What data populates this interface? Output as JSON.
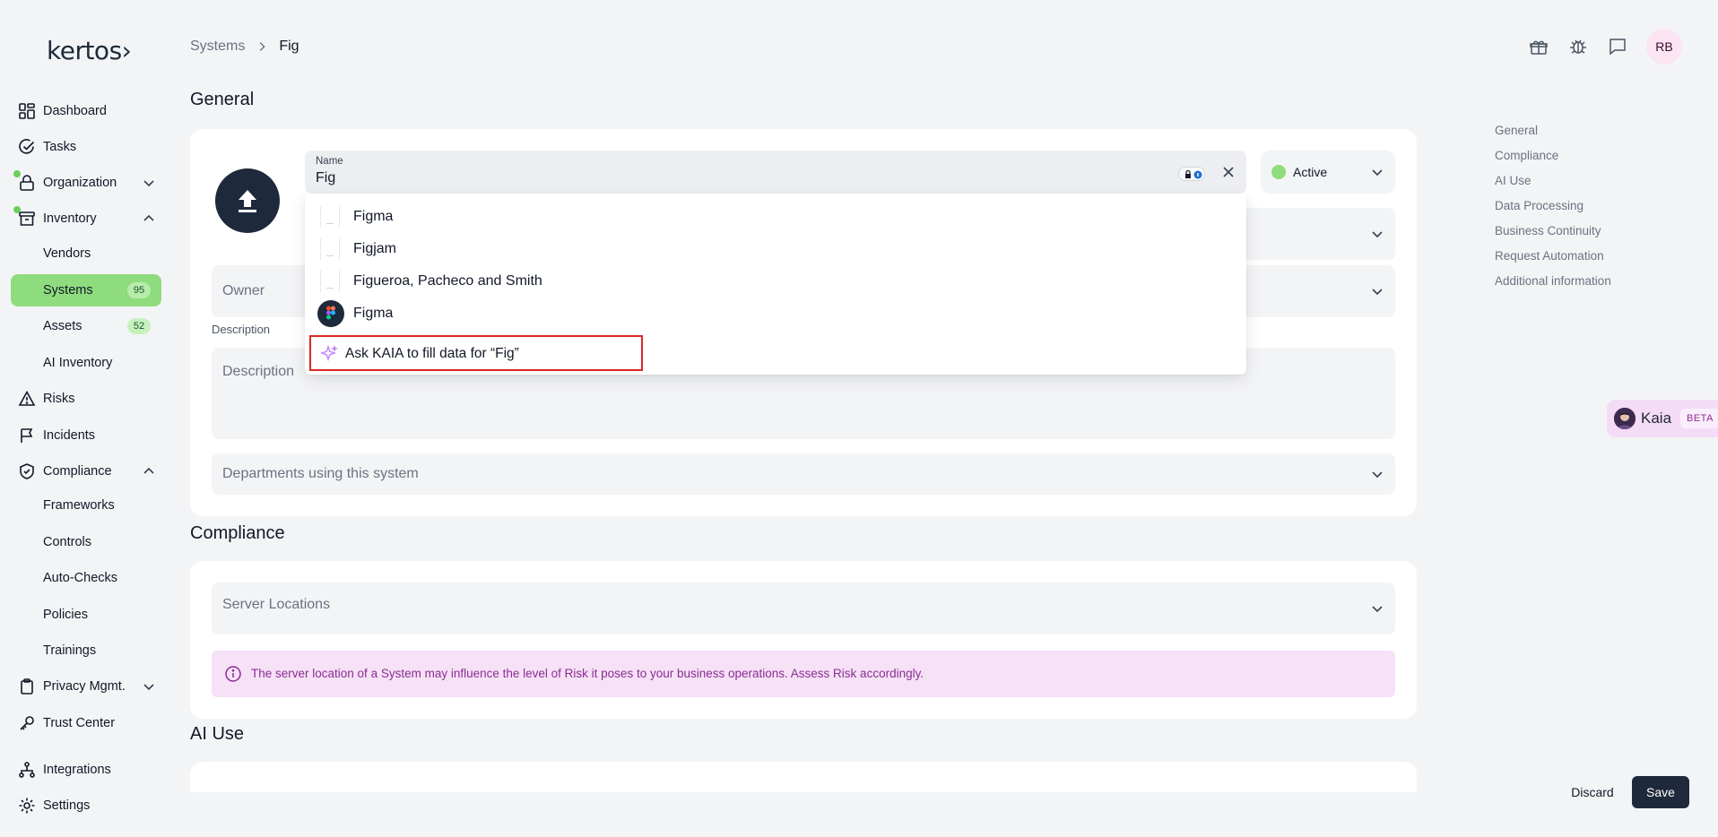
{
  "app": {
    "logo": "kertos›"
  },
  "sidebar": {
    "items": [
      {
        "label": "Dashboard",
        "icon": "dashboard-icon"
      },
      {
        "label": "Tasks",
        "icon": "check-circle-icon"
      },
      {
        "label": "Organization",
        "icon": "lock-icon"
      },
      {
        "label": "Inventory",
        "icon": "archive-icon"
      },
      {
        "label": "Vendors"
      },
      {
        "label": "Systems",
        "badge": "95"
      },
      {
        "label": "Assets",
        "badge": "52"
      },
      {
        "label": "AI Inventory"
      },
      {
        "label": "Risks",
        "icon": "warning-icon"
      },
      {
        "label": "Incidents",
        "icon": "flag-icon"
      },
      {
        "label": "Compliance",
        "icon": "shield-icon"
      },
      {
        "label": "Frameworks"
      },
      {
        "label": "Controls"
      },
      {
        "label": "Auto-Checks"
      },
      {
        "label": "Policies"
      },
      {
        "label": "Trainings"
      },
      {
        "label": "Privacy Mgmt.",
        "icon": "clipboard-icon"
      },
      {
        "label": "Trust Center",
        "icon": "key-icon"
      },
      {
        "label": "Integrations",
        "icon": "network-icon"
      },
      {
        "label": "Settings",
        "icon": "gear-icon"
      }
    ]
  },
  "header": {
    "breadcrumb": [
      "Systems",
      "Fig"
    ],
    "avatar": "RB"
  },
  "general": {
    "title": "General",
    "name_label": "Name",
    "name_value": "Fig",
    "status": "Active",
    "owner_placeholder": "Owner",
    "description_label": "Description",
    "description_placeholder": "Description",
    "departments_placeholder": "Departments using this system"
  },
  "dropdown": {
    "options": [
      "Figma",
      "Figjam",
      "Figueroa, Pacheco and Smith",
      "Figma"
    ],
    "kaia_fill": "Ask KAIA to fill data for “Fig”"
  },
  "compliance": {
    "title": "Compliance",
    "server_locations_placeholder": "Server Locations",
    "info": "The server location of a System may influence the level of Risk it poses to your business operations. Assess Risk accordingly."
  },
  "ai_use": {
    "title": "AI Use"
  },
  "toc": [
    "General",
    "Compliance",
    "AI Use",
    "Data Processing",
    "Business Continuity",
    "Request Automation",
    "Additional information"
  ],
  "kaia": {
    "name": "Kaia",
    "badge": "BETA"
  },
  "footer": {
    "discard": "Discard",
    "save": "Save"
  },
  "colors": {
    "accent_green": "#8fdc7e",
    "dark": "#1e293b",
    "info_bg": "#f6e1f7",
    "info_text": "#8a2d91",
    "highlight": "#dc2626"
  }
}
